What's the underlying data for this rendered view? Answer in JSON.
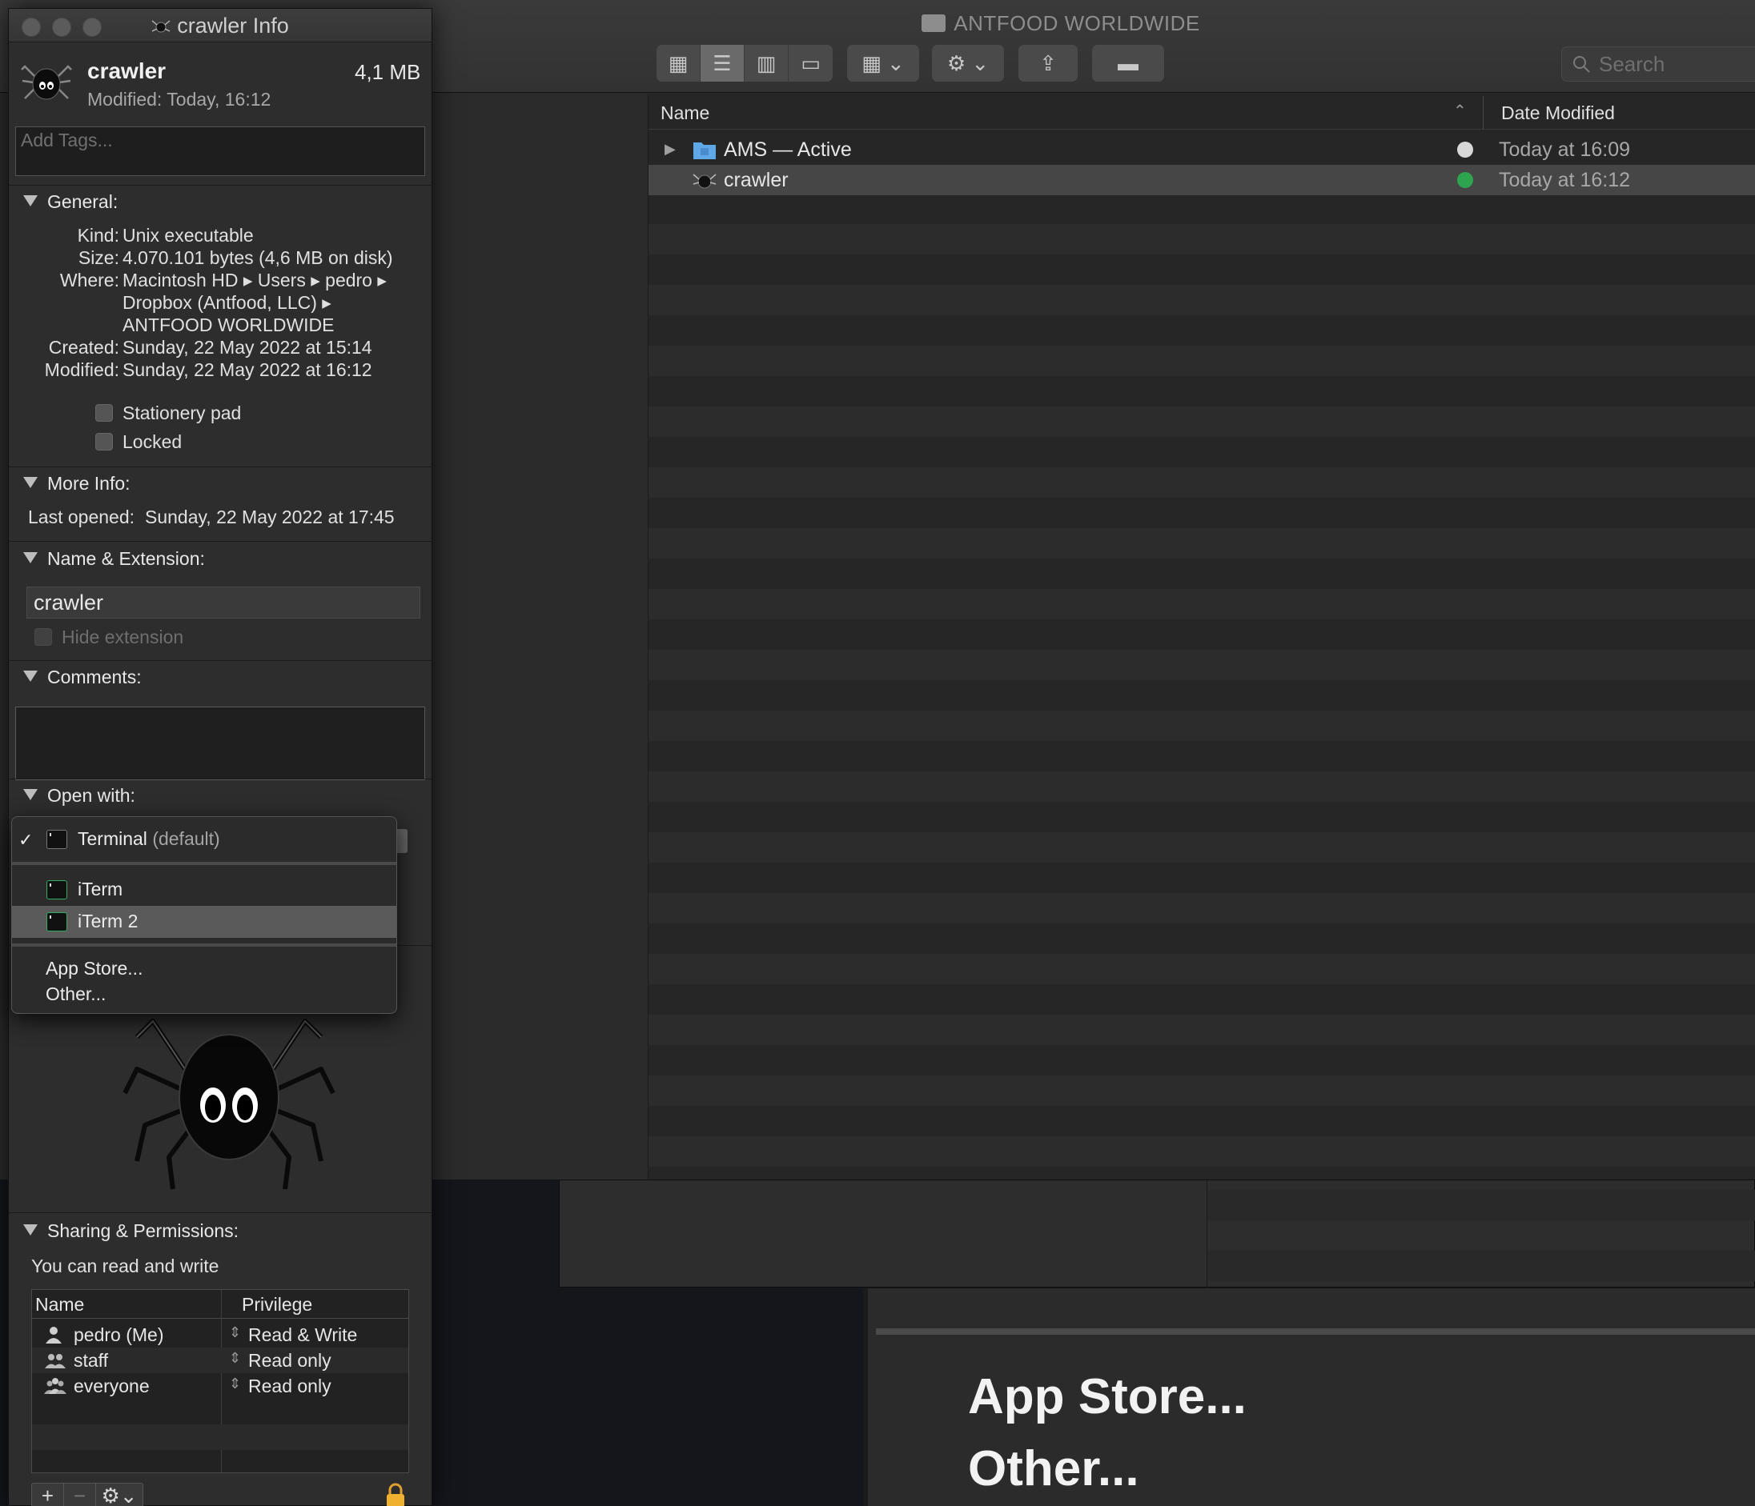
{
  "finder": {
    "title": "ANTFOOD WORLDWIDE",
    "search_placeholder": "Search",
    "columns": {
      "name": "Name",
      "date": "Date Modified"
    },
    "rows": [
      {
        "name": "AMS — Active",
        "date": "Today at 16:09",
        "type": "folder",
        "status": "cloud"
      },
      {
        "name": "crawler",
        "date": "Today at 16:12",
        "type": "executable",
        "status": "synced"
      }
    ]
  },
  "info": {
    "window_title": "crawler Info",
    "file_name": "crawler",
    "file_size": "4,1 MB",
    "modified_short": "Modified:  Today, 16:12",
    "tags_placeholder": "Add Tags...",
    "general": {
      "title": "General:",
      "kind_label": "Kind:",
      "kind": "Unix executable",
      "size_label": "Size:",
      "size": "4.070.101 bytes (4,6 MB on disk)",
      "where_label": "Where:",
      "where_line1": "Macintosh HD ▸ Users ▸ pedro ▸",
      "where_line2": "Dropbox (Antfood, LLC) ▸",
      "where_line3": "ANTFOOD WORLDWIDE",
      "created_label": "Created:",
      "created": "Sunday, 22 May 2022 at 15:14",
      "modified_label": "Modified:",
      "modified": "Sunday, 22 May 2022 at 16:12",
      "stationery": "Stationery pad",
      "locked": "Locked"
    },
    "more_info": {
      "title": "More Info:",
      "last_opened_label": "Last opened:",
      "last_opened": "Sunday, 22 May 2022 at 17:45"
    },
    "name_ext": {
      "title": "Name & Extension:",
      "value": "crawler",
      "hide_extension": "Hide extension"
    },
    "comments": {
      "title": "Comments:"
    },
    "open_with": {
      "title": "Open with:",
      "menu": {
        "default_app": "Terminal",
        "default_suffix": "(default)",
        "items": [
          "iTerm",
          "iTerm 2"
        ],
        "highlighted": "iTerm 2",
        "extra": [
          "App Store...",
          "Other..."
        ]
      }
    },
    "sharing": {
      "title": "Sharing & Permissions:",
      "status": "You can read and write",
      "col_name": "Name",
      "col_priv": "Privilege",
      "rows": [
        {
          "name": "pedro (Me)",
          "priv": "Read & Write"
        },
        {
          "name": "staff",
          "priv": "Read only"
        },
        {
          "name": "everyone",
          "priv": "Read only"
        }
      ]
    }
  },
  "zoom": {
    "line1": "App Store...",
    "line2": "Other..."
  },
  "colors": {
    "synced": "#2ea44f",
    "highlight": "#5a5a5a",
    "folder": "#5fa8e8"
  }
}
